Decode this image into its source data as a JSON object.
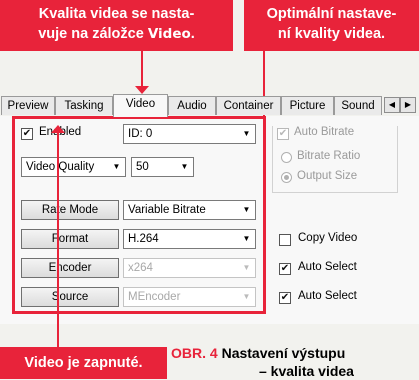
{
  "callouts": {
    "video_tab": [
      "Kvalita videa se nasta-",
      "vuje na záložce ",
      "Video",
      "."
    ],
    "quality": [
      "Optimální nastave-",
      "ní kvality videa."
    ],
    "enabled": "Video je zapnuté."
  },
  "tabs": [
    "Preview",
    "Tasking",
    "Video",
    "Audio",
    "Container",
    "Picture",
    "Sound"
  ],
  "active_tab": "Video",
  "enabled_checkbox": {
    "label": "Enabled",
    "checked": true
  },
  "stream_combo": "ID: 0",
  "quality": {
    "mode": "Video Quality",
    "value": "50"
  },
  "rate_mode": {
    "button": "Rate Mode",
    "value": "Variable Bitrate"
  },
  "format": {
    "button": "Format",
    "value": "H.264"
  },
  "encoder": {
    "button": "Encoder",
    "value": "x264"
  },
  "source": {
    "button": "Source",
    "value": "MEncoder"
  },
  "bitrate_group": {
    "title": "Auto Bitrate",
    "options": [
      "Bitrate Ratio",
      "Output Size"
    ],
    "selected": "Output Size"
  },
  "copy_video": {
    "label": "Copy Video",
    "checked": false
  },
  "auto_select_encoder": {
    "label": "Auto Select",
    "checked": true
  },
  "auto_select_source": {
    "label": "Auto Select",
    "checked": true
  },
  "caption": {
    "prefix": "OBR. 4",
    "text_line1": " Nastavení výstupu",
    "text_line2": "– kvalita videa"
  },
  "colors": {
    "accent": "#e8233a"
  }
}
